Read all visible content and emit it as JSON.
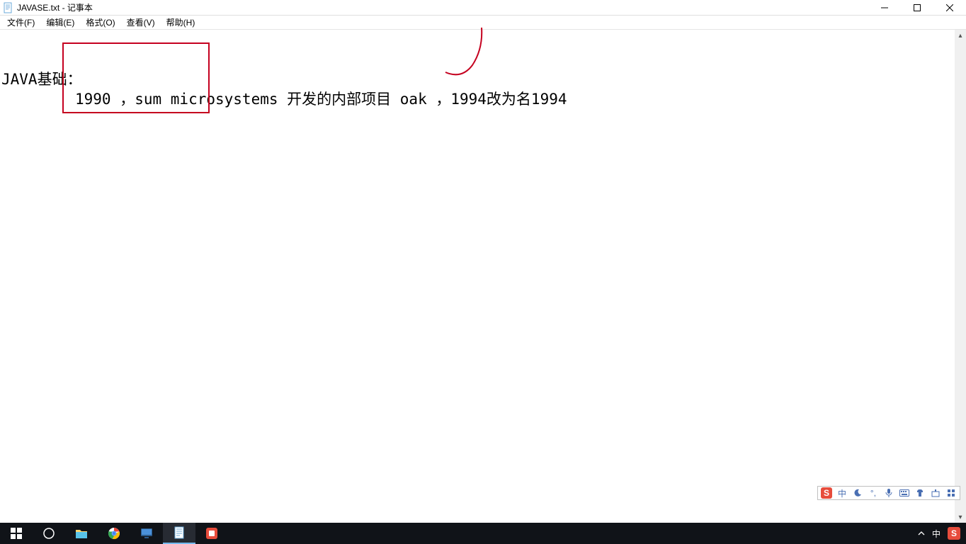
{
  "window": {
    "title": "JAVASE.txt - 记事本"
  },
  "menu": {
    "items": [
      "文件(F)",
      "编辑(E)",
      "格式(O)",
      "查看(V)",
      "帮助(H)"
    ]
  },
  "editor": {
    "line1": "JAVA基础：",
    "line2": "1990 ，sum microsystems 开发的内部项目 oak ，1994改为名1994"
  },
  "ime": {
    "logo": "S",
    "mode": "中"
  },
  "tray": {
    "arrow": "^",
    "lang": "中",
    "logo": "S"
  }
}
